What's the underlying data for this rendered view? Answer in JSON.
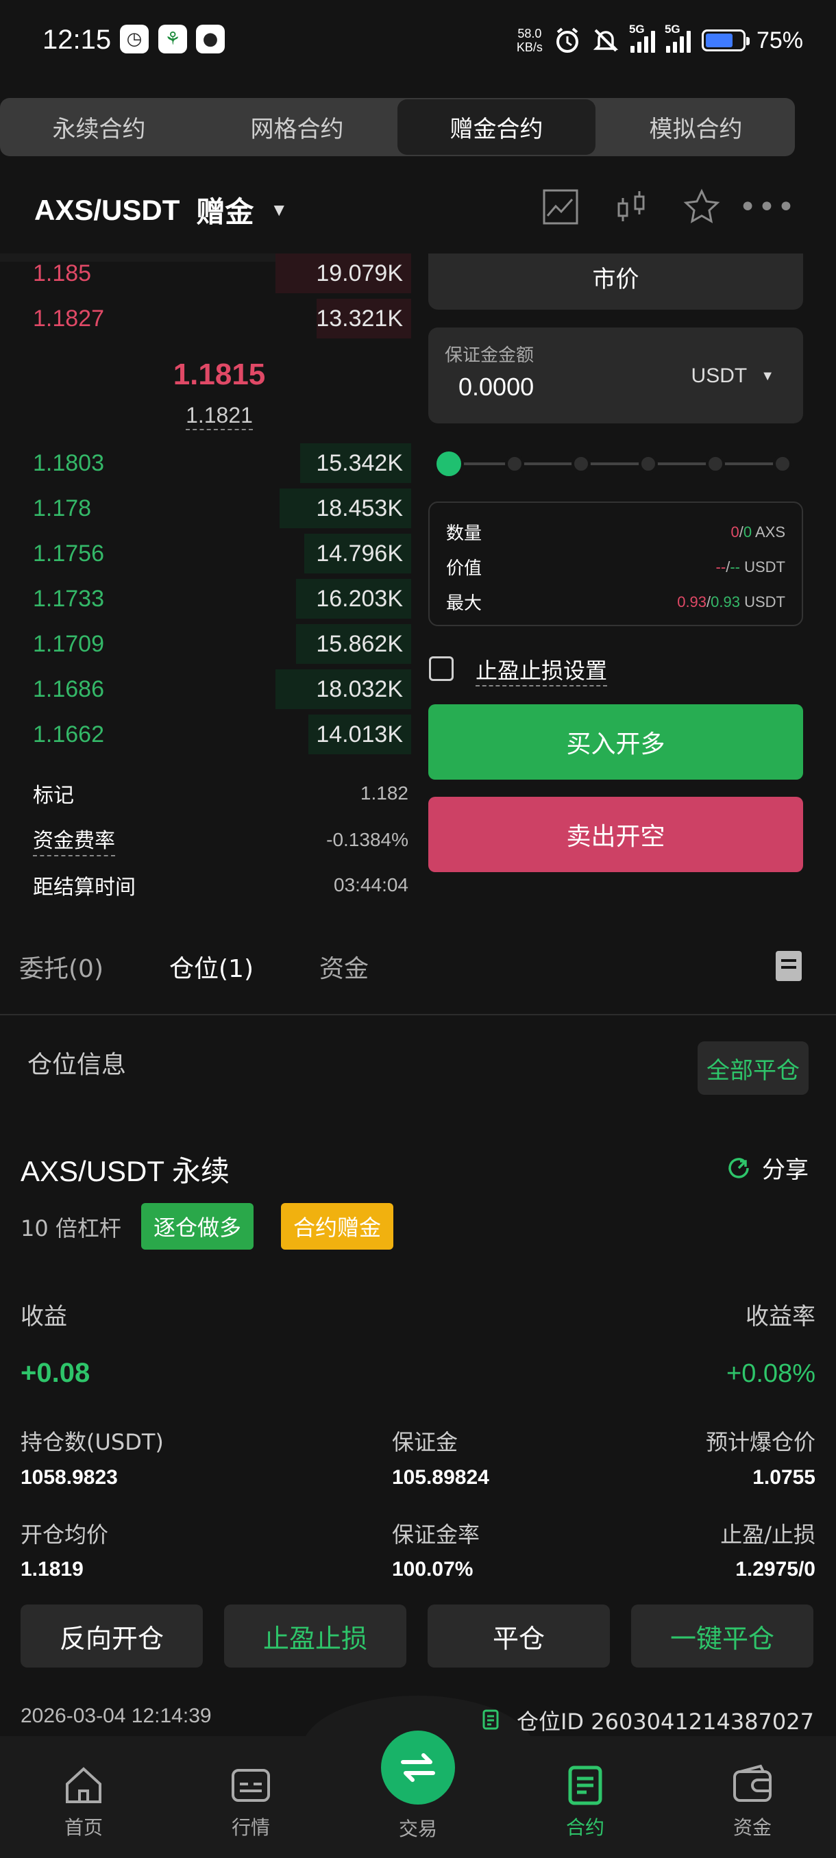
{
  "status_bar": {
    "time": "12:15",
    "speed_value": "58.0",
    "speed_unit": "KB/s",
    "net1": "5G",
    "net2": "5G",
    "battery_pct": "75%"
  },
  "contract_tabs": [
    {
      "label": "永续合约",
      "active": false
    },
    {
      "label": "网格合约",
      "active": false
    },
    {
      "label": "赠金合约",
      "active": true
    },
    {
      "label": "模拟合约",
      "active": false
    }
  ],
  "header": {
    "pair": "AXS/USDT",
    "mode": "赠金"
  },
  "orderbook": {
    "asks": [
      {
        "price": "1.185",
        "qty": "19.079K",
        "depth": 0.33
      },
      {
        "price": "1.1827",
        "qty": "13.321K",
        "depth": 0.23
      }
    ],
    "mid_price": "1.1815",
    "mark_price": "1.1821",
    "bids": [
      {
        "price": "1.1803",
        "qty": "15.342K",
        "depth": 0.27
      },
      {
        "price": "1.178",
        "qty": "18.453K",
        "depth": 0.32
      },
      {
        "price": "1.1756",
        "qty": "14.796K",
        "depth": 0.26
      },
      {
        "price": "1.1733",
        "qty": "16.203K",
        "depth": 0.28
      },
      {
        "price": "1.1709",
        "qty": "15.862K",
        "depth": 0.28
      },
      {
        "price": "1.1686",
        "qty": "18.032K",
        "depth": 0.33
      },
      {
        "price": "1.1662",
        "qty": "14.013K",
        "depth": 0.25
      }
    ],
    "info": [
      {
        "label": "标记",
        "value": "1.182"
      },
      {
        "label": "资金费率",
        "value": "-0.1384%"
      },
      {
        "label": "距结算时间",
        "value": "03:44:04"
      }
    ]
  },
  "order_form": {
    "order_type": "市价",
    "margin_label": "保证金金额",
    "margin_value": "0.0000",
    "margin_unit": "USDT",
    "slider_level": 0,
    "summary": [
      {
        "label": "数量",
        "a": "0",
        "b": "0",
        "unit": "AXS"
      },
      {
        "label": "价值",
        "a": "--",
        "b": "--",
        "unit": "USDT"
      },
      {
        "label": "最大",
        "a": "0.93",
        "b": "0.93",
        "unit": "USDT"
      }
    ],
    "tpsl_label": "止盈止损设置",
    "buy_label": "买入开多",
    "sell_label": "卖出开空"
  },
  "bottom_tabs": [
    {
      "label": "委托(0)",
      "active": false
    },
    {
      "label": "仓位(1)",
      "active": true
    },
    {
      "label": "资金",
      "active": false
    }
  ],
  "position": {
    "section_title": "仓位信息",
    "close_all": "全部平仓",
    "name": "AXS/USDT 永续",
    "share": "分享",
    "leverage": "10 倍杠杆",
    "tag_side": "逐仓做多",
    "tag_bonus": "合约赠金",
    "pnl_label": "收益",
    "pnl_value": "+0.08",
    "roe_label": "收益率",
    "roe_value": "+0.08%",
    "stats": [
      {
        "label": "持仓数(USDT)",
        "value": "1058.9823"
      },
      {
        "label": "保证金",
        "value": "105.89824"
      },
      {
        "label": "预计爆仓价",
        "value": "1.0755"
      },
      {
        "label": "开仓均价",
        "value": "1.1819"
      },
      {
        "label": "保证金率",
        "value": "100.07%"
      },
      {
        "label": "止盈/止损",
        "value": "1.2975/0"
      }
    ],
    "actions": [
      "反向开仓",
      "止盈止损",
      "平仓",
      "一键平仓"
    ],
    "timestamp": "2026-03-04 12:14:39",
    "position_id": "仓位ID 2603041214387027"
  },
  "nav": [
    {
      "label": "首页",
      "icon": "home-icon",
      "active": false
    },
    {
      "label": "行情",
      "icon": "market-icon",
      "active": false
    },
    {
      "label": "交易",
      "icon": "swap-icon",
      "active": false
    },
    {
      "label": "合约",
      "icon": "contract-icon",
      "active": true
    },
    {
      "label": "资金",
      "icon": "wallet-icon",
      "active": false
    }
  ],
  "colors": {
    "green": "#27ad52",
    "red": "#cd4165",
    "accent": "#18b368"
  }
}
